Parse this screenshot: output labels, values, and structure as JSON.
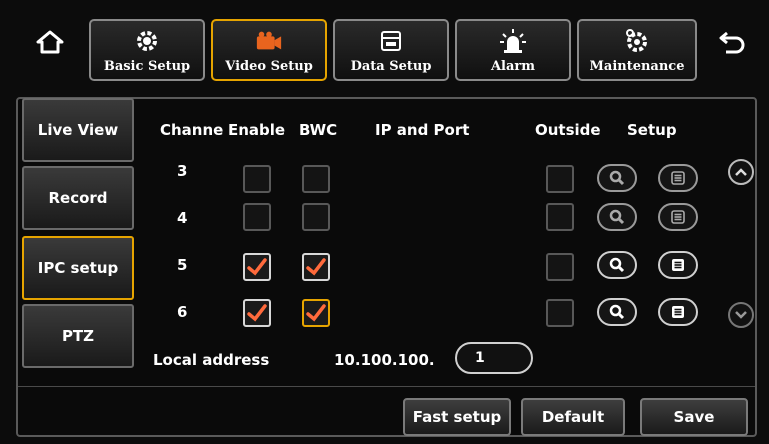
{
  "nav": {
    "home_icon": "home-icon",
    "back_icon": "back-arrow-icon",
    "tabs": [
      {
        "label": "Basic Setup",
        "icon": "gear-icon"
      },
      {
        "label": "Video Setup",
        "icon": "video-camera-icon",
        "active": true
      },
      {
        "label": "Data Setup",
        "icon": "storage-icon"
      },
      {
        "label": "Alarm",
        "icon": "alarm-light-icon"
      },
      {
        "label": "Maintenance",
        "icon": "maintenance-gear-icon"
      }
    ]
  },
  "sidebar": {
    "items": [
      {
        "label": "Live View"
      },
      {
        "label": "Record"
      },
      {
        "label": "IPC setup",
        "active": true
      },
      {
        "label": "PTZ"
      }
    ]
  },
  "table": {
    "headers": {
      "channel": "Channe",
      "enable": "Enable",
      "bwc": "BWC",
      "ip_port": "IP and Port",
      "outside": "Outside",
      "setup": "Setup"
    },
    "rows": [
      {
        "channel": "3",
        "enable": false,
        "bwc": false,
        "outside": false
      },
      {
        "channel": "4",
        "enable": false,
        "bwc": false,
        "outside": false
      },
      {
        "channel": "5",
        "enable": true,
        "bwc": true,
        "outside": false
      },
      {
        "channel": "6",
        "enable": true,
        "bwc": true,
        "outside": false
      }
    ]
  },
  "local_address": {
    "label": "Local address",
    "prefix": "10.100.100.",
    "value": "1"
  },
  "buttons": {
    "fast_setup": "Fast setup",
    "default": "Default",
    "save": "Save"
  },
  "colors": {
    "accent": "#e6a400",
    "check": "#ff6a3c",
    "camera": "#e8641e"
  }
}
